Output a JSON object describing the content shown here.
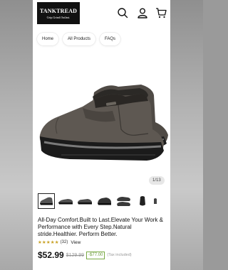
{
  "brand": {
    "name": "TANKTREAD",
    "tagline": "Grip.Grind.Outlast."
  },
  "header": {
    "icons": [
      "search-icon",
      "account-icon",
      "cart-icon"
    ]
  },
  "nav": {
    "items": [
      {
        "label": "Home"
      },
      {
        "label": "All Products"
      },
      {
        "label": "FAQs"
      }
    ]
  },
  "gallery": {
    "counter": "1/13",
    "current_index": 1,
    "total": 13
  },
  "product": {
    "title": "All-Day Comfort.Built to Last.Elevate Your Work & Performance with Every Step.Natural stride.Healthier. Perform Better.",
    "rating_stars": "★★★★★",
    "rating_value": 5,
    "rating_count": "(32)",
    "view_label": "View",
    "price": "$52.99",
    "compare_price": "$129.99",
    "savings": "-$77.00",
    "tax_note": "(Tax included)"
  },
  "colors": {
    "shoe_upper": "#5e5852",
    "shoe_sole": "#1c1c1c",
    "stars": "#c9a227",
    "savings": "#6a9a38",
    "page_background": "#9a9a9a"
  }
}
